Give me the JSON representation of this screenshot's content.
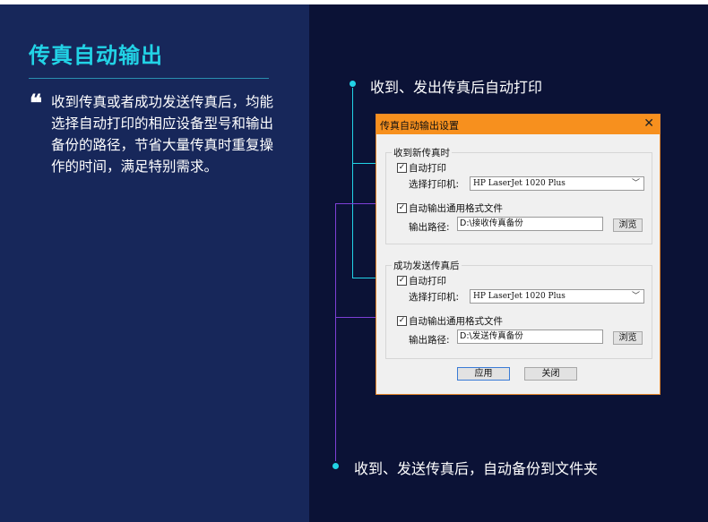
{
  "title": "传真自动输出",
  "description": "收到传真或者成功发送传真后，均能选择自动打印的相应设备型号和输出备份的路径，节省大量传真时重复操作的时间，满足特别需求。",
  "quote_mark": "❝",
  "callouts": {
    "receive": "收到、发出传真后自动打印",
    "backup": "收到、发送传真后，自动备份到文件夹"
  },
  "colors": {
    "accent": "#22d3e6",
    "purple": "#7e3fd6",
    "dialog_title": "#f7901e"
  },
  "dialog": {
    "title": "传真自动输出设置",
    "close": "✕",
    "receive_group": {
      "label": "收到新传真时",
      "auto_print": "自动打印",
      "printer_label": "选择打印机:",
      "printer_value": "HP LaserJet 1020 Plus",
      "auto_export": "自动输出通用格式文件",
      "path_label": "输出路径:",
      "path_value": "D:\\接收传真备份",
      "browse": "浏览"
    },
    "send_group": {
      "label": "成功发送传真后",
      "auto_print": "自动打印",
      "printer_label": "选择打印机:",
      "printer_value": "HP LaserJet 1020 Plus",
      "auto_export": "自动输出通用格式文件",
      "path_label": "输出路径:",
      "path_value": "D:\\发送传真备份",
      "browse": "浏览"
    },
    "apply": "应用",
    "close_button": "关闭"
  }
}
